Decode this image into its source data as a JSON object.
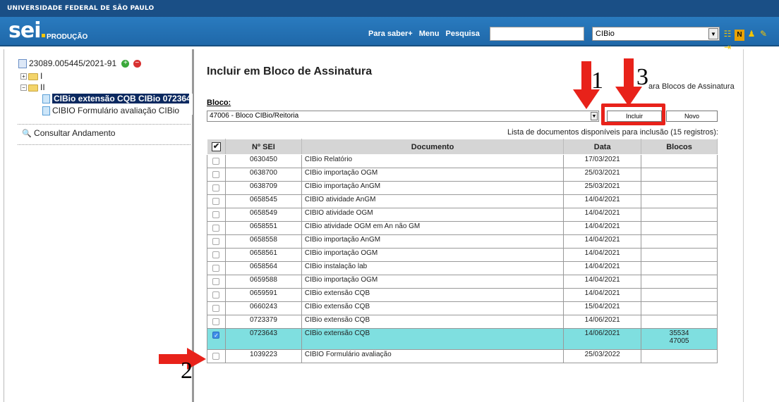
{
  "header": {
    "org": "UNIVERSIDADE FEDERAL DE SÃO PAULO",
    "logo": "sei",
    "environment": "PRODUÇÃO",
    "nav": [
      "Para saber+",
      "Menu",
      "Pesquisa"
    ],
    "search_value": "",
    "unit_value": "CIBio",
    "icons": [
      "list-icon",
      "note-icon",
      "user-icon",
      "tools-icon",
      "exit-icon"
    ]
  },
  "tree": {
    "process": "23089.005445/2021-91",
    "folder1": "I",
    "folder2": "II",
    "doc1": "CIBio extensão CQB CIBio 072364",
    "doc2": "CIBIO Formulário avaliação CIBio",
    "consultar": "Consultar Andamento"
  },
  "main": {
    "title": "Incluir em Bloco de Assinatura",
    "back_link": "ara Blocos de Assinatura",
    "bloco_label": "Bloco:",
    "bloco_value": "47006 - Bloco CIBio/Reitoria",
    "btn_incluir": "Incluir",
    "btn_novo": "Novo",
    "caption": "Lista de documentos disponíveis para inclusão (15 registros):"
  },
  "table": {
    "headers": [
      "Nº SEI",
      "Documento",
      "Data",
      "Blocos"
    ],
    "rows": [
      {
        "sei": "0630450",
        "doc": "CIBio Relatório",
        "data": "17/03/2021",
        "blocos": "",
        "checked": false
      },
      {
        "sei": "0638700",
        "doc": "CIBio importação OGM",
        "data": "25/03/2021",
        "blocos": "",
        "checked": false
      },
      {
        "sei": "0638709",
        "doc": "CIBio importação AnGM",
        "data": "25/03/2021",
        "blocos": "",
        "checked": false
      },
      {
        "sei": "0658545",
        "doc": "CIBIO atividade AnGM",
        "data": "14/04/2021",
        "blocos": "",
        "checked": false
      },
      {
        "sei": "0658549",
        "doc": "CIBIO atividade OGM",
        "data": "14/04/2021",
        "blocos": "",
        "checked": false
      },
      {
        "sei": "0658551",
        "doc": "CIBio atividade OGM em An não GM",
        "data": "14/04/2021",
        "blocos": "",
        "checked": false
      },
      {
        "sei": "0658558",
        "doc": "CIBio importação AnGM",
        "data": "14/04/2021",
        "blocos": "",
        "checked": false
      },
      {
        "sei": "0658561",
        "doc": "CIBio importação OGM",
        "data": "14/04/2021",
        "blocos": "",
        "checked": false
      },
      {
        "sei": "0658564",
        "doc": "CIBio instalação lab",
        "data": "14/04/2021",
        "blocos": "",
        "checked": false
      },
      {
        "sei": "0659588",
        "doc": "CIBio importação OGM",
        "data": "14/04/2021",
        "blocos": "",
        "checked": false
      },
      {
        "sei": "0659591",
        "doc": "CIBio extensão CQB",
        "data": "14/04/2021",
        "blocos": "",
        "checked": false
      },
      {
        "sei": "0660243",
        "doc": "CIBio extensão CQB",
        "data": "15/04/2021",
        "blocos": "",
        "checked": false
      },
      {
        "sei": "0723379",
        "doc": "CIBio extensão CQB",
        "data": "14/06/2021",
        "blocos": "",
        "checked": false
      },
      {
        "sei": "0723643",
        "doc": "CIBio extensão CQB",
        "data": "14/06/2021",
        "blocos": "35534\n47005",
        "checked": true
      },
      {
        "sei": "1039223",
        "doc": "CIBIO Formulário avaliação",
        "data": "25/03/2022",
        "blocos": "",
        "checked": false
      }
    ]
  },
  "annotations": {
    "n1": "1",
    "n2": "2",
    "n3": "3",
    "arrow_color": "#e8221a"
  }
}
